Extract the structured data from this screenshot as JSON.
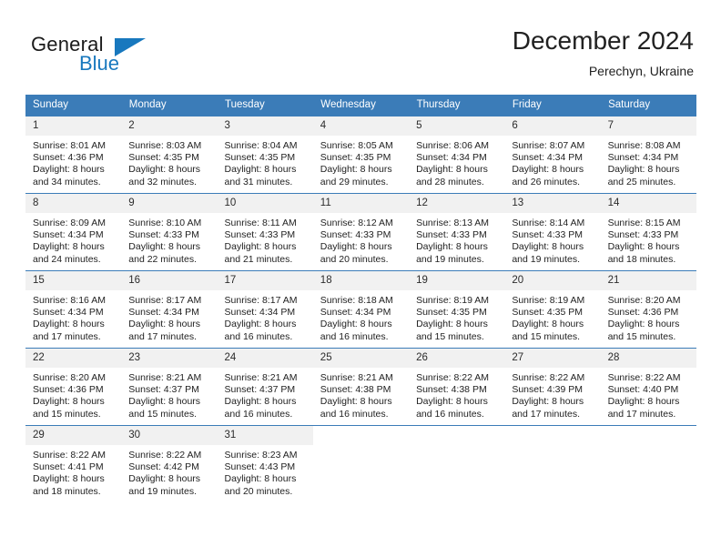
{
  "brand": {
    "name_top": "General",
    "name_bottom": "Blue",
    "accent_color": "#1878be",
    "triangle_icon": "triangle-icon"
  },
  "header": {
    "title": "December 2024",
    "subtitle": "Perechyn, Ukraine"
  },
  "colors": {
    "header_blue": "#3b7cb8",
    "daynum_band": "#f1f1f1",
    "text": "#222222"
  },
  "calendar": {
    "weekday_headers": [
      "Sunday",
      "Monday",
      "Tuesday",
      "Wednesday",
      "Thursday",
      "Friday",
      "Saturday"
    ],
    "weeks": [
      [
        {
          "day": "1",
          "sunrise": "Sunrise: 8:01 AM",
          "sunset": "Sunset: 4:36 PM",
          "daylight1": "Daylight: 8 hours",
          "daylight2": "and 34 minutes."
        },
        {
          "day": "2",
          "sunrise": "Sunrise: 8:03 AM",
          "sunset": "Sunset: 4:35 PM",
          "daylight1": "Daylight: 8 hours",
          "daylight2": "and 32 minutes."
        },
        {
          "day": "3",
          "sunrise": "Sunrise: 8:04 AM",
          "sunset": "Sunset: 4:35 PM",
          "daylight1": "Daylight: 8 hours",
          "daylight2": "and 31 minutes."
        },
        {
          "day": "4",
          "sunrise": "Sunrise: 8:05 AM",
          "sunset": "Sunset: 4:35 PM",
          "daylight1": "Daylight: 8 hours",
          "daylight2": "and 29 minutes."
        },
        {
          "day": "5",
          "sunrise": "Sunrise: 8:06 AM",
          "sunset": "Sunset: 4:34 PM",
          "daylight1": "Daylight: 8 hours",
          "daylight2": "and 28 minutes."
        },
        {
          "day": "6",
          "sunrise": "Sunrise: 8:07 AM",
          "sunset": "Sunset: 4:34 PM",
          "daylight1": "Daylight: 8 hours",
          "daylight2": "and 26 minutes."
        },
        {
          "day": "7",
          "sunrise": "Sunrise: 8:08 AM",
          "sunset": "Sunset: 4:34 PM",
          "daylight1": "Daylight: 8 hours",
          "daylight2": "and 25 minutes."
        }
      ],
      [
        {
          "day": "8",
          "sunrise": "Sunrise: 8:09 AM",
          "sunset": "Sunset: 4:34 PM",
          "daylight1": "Daylight: 8 hours",
          "daylight2": "and 24 minutes."
        },
        {
          "day": "9",
          "sunrise": "Sunrise: 8:10 AM",
          "sunset": "Sunset: 4:33 PM",
          "daylight1": "Daylight: 8 hours",
          "daylight2": "and 22 minutes."
        },
        {
          "day": "10",
          "sunrise": "Sunrise: 8:11 AM",
          "sunset": "Sunset: 4:33 PM",
          "daylight1": "Daylight: 8 hours",
          "daylight2": "and 21 minutes."
        },
        {
          "day": "11",
          "sunrise": "Sunrise: 8:12 AM",
          "sunset": "Sunset: 4:33 PM",
          "daylight1": "Daylight: 8 hours",
          "daylight2": "and 20 minutes."
        },
        {
          "day": "12",
          "sunrise": "Sunrise: 8:13 AM",
          "sunset": "Sunset: 4:33 PM",
          "daylight1": "Daylight: 8 hours",
          "daylight2": "and 19 minutes."
        },
        {
          "day": "13",
          "sunrise": "Sunrise: 8:14 AM",
          "sunset": "Sunset: 4:33 PM",
          "daylight1": "Daylight: 8 hours",
          "daylight2": "and 19 minutes."
        },
        {
          "day": "14",
          "sunrise": "Sunrise: 8:15 AM",
          "sunset": "Sunset: 4:33 PM",
          "daylight1": "Daylight: 8 hours",
          "daylight2": "and 18 minutes."
        }
      ],
      [
        {
          "day": "15",
          "sunrise": "Sunrise: 8:16 AM",
          "sunset": "Sunset: 4:34 PM",
          "daylight1": "Daylight: 8 hours",
          "daylight2": "and 17 minutes."
        },
        {
          "day": "16",
          "sunrise": "Sunrise: 8:17 AM",
          "sunset": "Sunset: 4:34 PM",
          "daylight1": "Daylight: 8 hours",
          "daylight2": "and 17 minutes."
        },
        {
          "day": "17",
          "sunrise": "Sunrise: 8:17 AM",
          "sunset": "Sunset: 4:34 PM",
          "daylight1": "Daylight: 8 hours",
          "daylight2": "and 16 minutes."
        },
        {
          "day": "18",
          "sunrise": "Sunrise: 8:18 AM",
          "sunset": "Sunset: 4:34 PM",
          "daylight1": "Daylight: 8 hours",
          "daylight2": "and 16 minutes."
        },
        {
          "day": "19",
          "sunrise": "Sunrise: 8:19 AM",
          "sunset": "Sunset: 4:35 PM",
          "daylight1": "Daylight: 8 hours",
          "daylight2": "and 15 minutes."
        },
        {
          "day": "20",
          "sunrise": "Sunrise: 8:19 AM",
          "sunset": "Sunset: 4:35 PM",
          "daylight1": "Daylight: 8 hours",
          "daylight2": "and 15 minutes."
        },
        {
          "day": "21",
          "sunrise": "Sunrise: 8:20 AM",
          "sunset": "Sunset: 4:36 PM",
          "daylight1": "Daylight: 8 hours",
          "daylight2": "and 15 minutes."
        }
      ],
      [
        {
          "day": "22",
          "sunrise": "Sunrise: 8:20 AM",
          "sunset": "Sunset: 4:36 PM",
          "daylight1": "Daylight: 8 hours",
          "daylight2": "and 15 minutes."
        },
        {
          "day": "23",
          "sunrise": "Sunrise: 8:21 AM",
          "sunset": "Sunset: 4:37 PM",
          "daylight1": "Daylight: 8 hours",
          "daylight2": "and 15 minutes."
        },
        {
          "day": "24",
          "sunrise": "Sunrise: 8:21 AM",
          "sunset": "Sunset: 4:37 PM",
          "daylight1": "Daylight: 8 hours",
          "daylight2": "and 16 minutes."
        },
        {
          "day": "25",
          "sunrise": "Sunrise: 8:21 AM",
          "sunset": "Sunset: 4:38 PM",
          "daylight1": "Daylight: 8 hours",
          "daylight2": "and 16 minutes."
        },
        {
          "day": "26",
          "sunrise": "Sunrise: 8:22 AM",
          "sunset": "Sunset: 4:38 PM",
          "daylight1": "Daylight: 8 hours",
          "daylight2": "and 16 minutes."
        },
        {
          "day": "27",
          "sunrise": "Sunrise: 8:22 AM",
          "sunset": "Sunset: 4:39 PM",
          "daylight1": "Daylight: 8 hours",
          "daylight2": "and 17 minutes."
        },
        {
          "day": "28",
          "sunrise": "Sunrise: 8:22 AM",
          "sunset": "Sunset: 4:40 PM",
          "daylight1": "Daylight: 8 hours",
          "daylight2": "and 17 minutes."
        }
      ],
      [
        {
          "day": "29",
          "sunrise": "Sunrise: 8:22 AM",
          "sunset": "Sunset: 4:41 PM",
          "daylight1": "Daylight: 8 hours",
          "daylight2": "and 18 minutes."
        },
        {
          "day": "30",
          "sunrise": "Sunrise: 8:22 AM",
          "sunset": "Sunset: 4:42 PM",
          "daylight1": "Daylight: 8 hours",
          "daylight2": "and 19 minutes."
        },
        {
          "day": "31",
          "sunrise": "Sunrise: 8:23 AM",
          "sunset": "Sunset: 4:43 PM",
          "daylight1": "Daylight: 8 hours",
          "daylight2": "and 20 minutes."
        },
        {
          "day": "",
          "sunrise": "",
          "sunset": "",
          "daylight1": "",
          "daylight2": ""
        },
        {
          "day": "",
          "sunrise": "",
          "sunset": "",
          "daylight1": "",
          "daylight2": ""
        },
        {
          "day": "",
          "sunrise": "",
          "sunset": "",
          "daylight1": "",
          "daylight2": ""
        },
        {
          "day": "",
          "sunrise": "",
          "sunset": "",
          "daylight1": "",
          "daylight2": ""
        }
      ]
    ]
  }
}
